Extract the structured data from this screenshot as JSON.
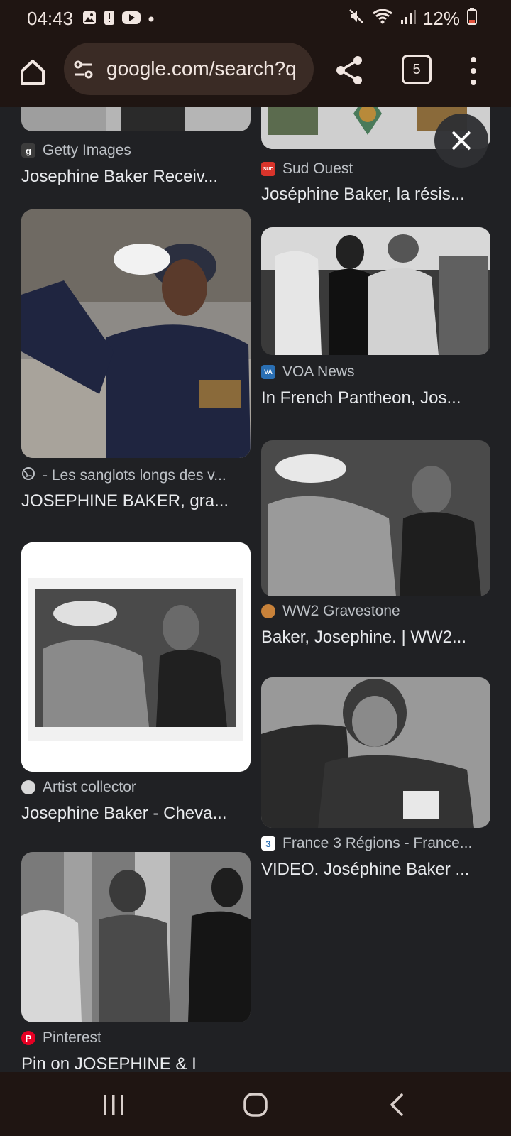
{
  "status_bar": {
    "time": "04:43",
    "battery": "12%"
  },
  "toolbar": {
    "url": "google.com/search?q",
    "tab_count": "5"
  },
  "results": [
    {
      "source": "Getty Images",
      "title": "Josephine Baker Receiv...",
      "favicon": "getty-icon"
    },
    {
      "source": "Sud Ouest",
      "title": "Joséphine Baker, la résis...",
      "favicon": "sud-ouest-icon"
    },
    {
      "source": "- Les sanglots longs des v...",
      "title": "JOSEPHINE BAKER, gra...",
      "favicon": "globe-icon"
    },
    {
      "source": "VOA News",
      "title": "In French Pantheon, Jos...",
      "favicon": "voa-icon"
    },
    {
      "source": "WW2 Gravestone",
      "title": "Baker, Josephine. | WW2...",
      "favicon": "ww2-icon"
    },
    {
      "source": "Artist collector",
      "title": "Josephine Baker - Cheva...",
      "favicon": "artist-collector-icon"
    },
    {
      "source": "France 3 Régions - France...",
      "title": "VIDEO. Joséphine Baker ...",
      "favicon": "france3-icon"
    },
    {
      "source": "Pinterest",
      "title": "Pin on JOSEPHINE & I",
      "favicon": "pinterest-icon"
    }
  ],
  "colors": {
    "chrome_bar": "#1f1512",
    "page_bg": "#202124",
    "url_pill": "#3a2b25",
    "text_primary": "#e8eaed",
    "text_secondary": "#bdc1c6",
    "battery_low": "#e5533d"
  }
}
